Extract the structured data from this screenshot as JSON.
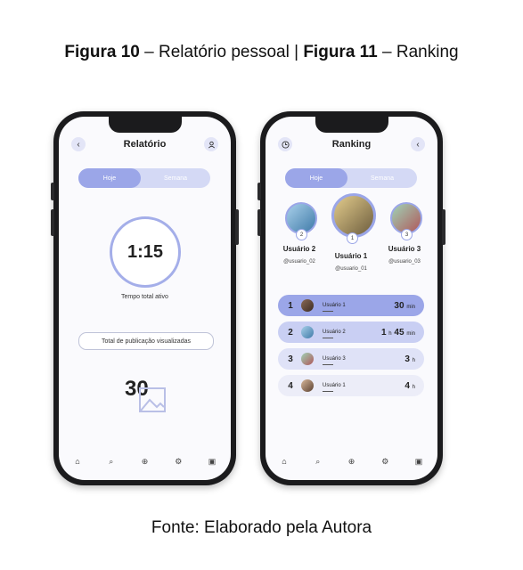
{
  "caption": {
    "fig10_label": "Figura 10",
    "fig10_text": " – Relatório pessoal | ",
    "fig11_label": "Figura 11",
    "fig11_text": " – Ranking",
    "source": "Fonte: Elaborado pela Autora"
  },
  "relatorio": {
    "title": "Relatório",
    "tabs": [
      "Hoje",
      "Semana"
    ],
    "timer_value": "1:15",
    "timer_label": "Tempo total ativo",
    "posts_button": "Total de publicação visualizadas",
    "posts_count": "30"
  },
  "ranking": {
    "title": "Ranking",
    "tabs": [
      "Hoje",
      "Semana"
    ],
    "podium": [
      {
        "rank": "2",
        "name": "Usuário 2",
        "handle": "@usuario_02"
      },
      {
        "rank": "1",
        "name": "Usuário 1",
        "handle": "@usuario_01"
      },
      {
        "rank": "3",
        "name": "Usuário 3",
        "handle": "@usuario_03"
      }
    ],
    "rows": [
      {
        "pos": "1",
        "name": "Usuário 1",
        "time_a": "30",
        "unit_a": "min",
        "time_b": "",
        "unit_b": ""
      },
      {
        "pos": "2",
        "name": "Usuário 2",
        "time_a": "1",
        "unit_a": "h",
        "time_b": "45",
        "unit_b": "min"
      },
      {
        "pos": "3",
        "name": "Usuário 3",
        "time_a": "3",
        "unit_a": "h",
        "time_b": "",
        "unit_b": ""
      },
      {
        "pos": "4",
        "name": "Usuário 1",
        "time_a": "4",
        "unit_a": "h",
        "time_b": "",
        "unit_b": ""
      }
    ]
  },
  "icons": {
    "back": "chevron-left-icon",
    "profile": "profile-icon",
    "history": "clock-icon",
    "nav": [
      "home-icon",
      "search-icon",
      "add-icon",
      "settings-icon",
      "user-icon"
    ]
  },
  "colors": {
    "accent": "#9ba6e8",
    "accent_light": "#d4d9f5",
    "row_highlight": "#c9cff3"
  }
}
